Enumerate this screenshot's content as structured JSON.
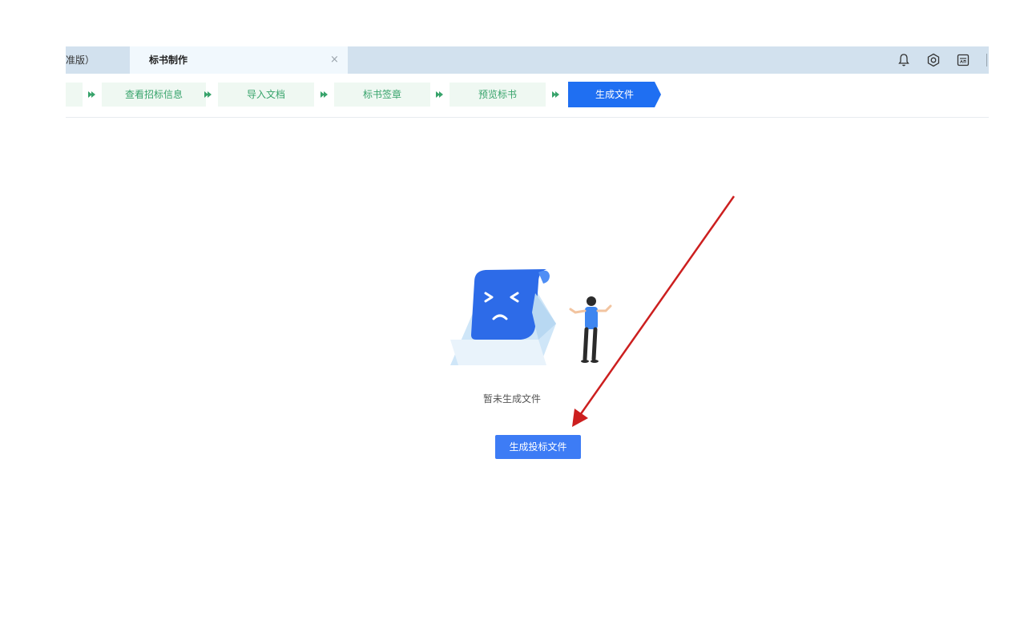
{
  "tabs": [
    {
      "label": "准版）",
      "active": false
    },
    {
      "label": "标书制作",
      "active": true,
      "close": "×"
    }
  ],
  "header_actions": [
    {
      "icon": "bell-icon"
    },
    {
      "icon": "settings-icon"
    },
    {
      "icon": "ca-certificate-icon"
    }
  ],
  "steps": [
    {
      "label": "",
      "state": "done"
    },
    {
      "label": "查看招标信息",
      "state": "done"
    },
    {
      "label": "导入文档",
      "state": "done"
    },
    {
      "label": "标书签章",
      "state": "done"
    },
    {
      "label": "预览标书",
      "state": "done"
    },
    {
      "label": "生成文件",
      "state": "active"
    }
  ],
  "empty_state": {
    "illustration": "empty-document-illustration",
    "message": "暂未生成文件",
    "button_label": "生成投标文件"
  },
  "annotation": {
    "type": "red-arrow",
    "points_to": "generate-bid-file-button"
  },
  "colors": {
    "tabbar_bg": "#d2e1ee",
    "step_done_text": "#37a36b",
    "step_done_bg": "#eff8f2",
    "step_active_bg": "#1f6ff2",
    "primary_button": "#3d7cf5",
    "annotation_arrow": "#cc1f1f"
  }
}
